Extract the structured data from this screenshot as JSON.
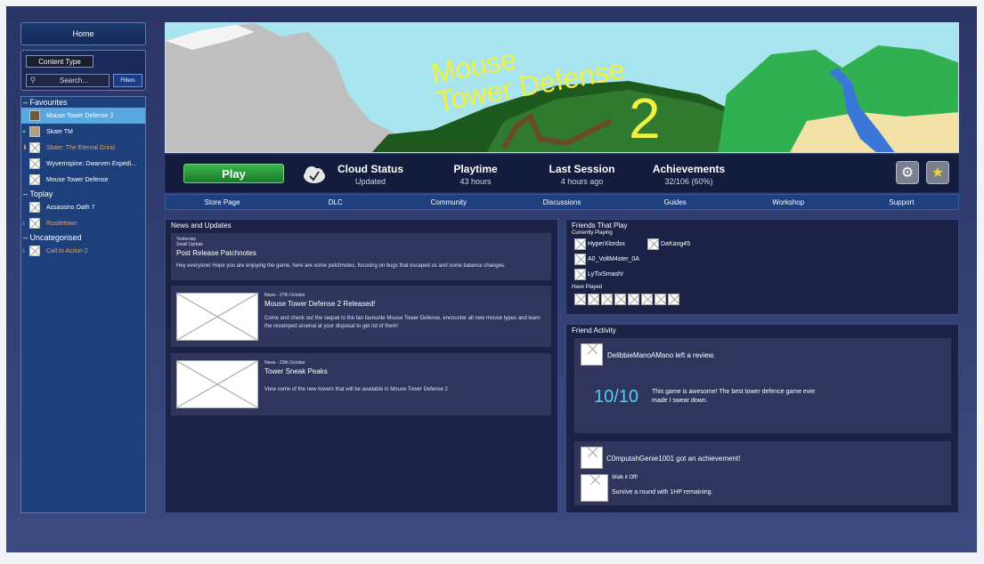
{
  "sidebar": {
    "home_label": "Home",
    "content_type_label": "Content Type",
    "search_placeholder": "Search...",
    "filters_label": "Filters",
    "categories": [
      {
        "name": "Favourites",
        "games": [
          {
            "title": "Mouse Tower Defense 2",
            "selected": true,
            "status": ""
          },
          {
            "title": "Skate TM",
            "selected": false,
            "status": "online"
          },
          {
            "title": "Skate: The Eternal Grind",
            "selected": false,
            "status": "update"
          },
          {
            "title": "Wyvernspine: Dwarven Expedi...",
            "selected": false,
            "status": ""
          },
          {
            "title": "Mouse Tower Defense",
            "selected": false,
            "status": ""
          }
        ]
      },
      {
        "name": "Toplay",
        "games": [
          {
            "title": "Assassins Oath 7",
            "selected": false,
            "status": ""
          },
          {
            "title": "Rustletown",
            "selected": false,
            "status": "download"
          }
        ]
      },
      {
        "name": "Uncategorised",
        "games": [
          {
            "title": "Call to Action 2",
            "selected": false,
            "status": "download"
          }
        ]
      }
    ]
  },
  "hero": {
    "logo_text_line1": "Mouse",
    "logo_text_line2": "Tower Defense",
    "logo_number": "2"
  },
  "infobar": {
    "play_label": "Play",
    "cloud_status_title": "Cloud Status",
    "cloud_status_value": "Updated",
    "playtime_title": "Playtime",
    "playtime_value": "43 hours",
    "last_session_title": "Last Session",
    "last_session_value": "4 hours ago",
    "achievements_title": "Achievements",
    "achievements_value": "32/106 (60%)"
  },
  "tabs": [
    "Store Page",
    "DLC",
    "Community",
    "Discussions",
    "Guides",
    "Workshop",
    "Support"
  ],
  "news": {
    "title": "News and Updates",
    "items": [
      {
        "date": "Yesterday",
        "type": "Small Update",
        "headline": "Post Release Patchnotes",
        "body": "Hey everyone! Hope you are enjoying the game, here are some patchnotes, focusing on bugs that escaped us and some balance changes."
      },
      {
        "meta": "News - 27th October",
        "headline": "Mouse Tower Defense 2 Released!",
        "body": "Come and check out the sequel to the fan favourite Mouse Tower Defense, encounter all new mouse types and learn the revamped arsenal at your disposal to get rid of them!"
      },
      {
        "meta": "News - 23th October",
        "headline": "Tower Sneak Peaks",
        "body": "View some of the new towers that will be available in Mouse Tower Defense 2"
      }
    ]
  },
  "friends": {
    "title": "Friends That Play",
    "currently_playing_label": "Currently Playing",
    "currently_playing": [
      "HyperXlordxx",
      "DaKang45",
      "A0_VoltM4ster_0A",
      "LyTixSmash!"
    ],
    "have_played_label": "Have Played",
    "have_played_count": 8
  },
  "activity": {
    "title": "Friend Activity",
    "review": {
      "text": "DelibbieManoAMano left a review.",
      "score": "10/10",
      "quote": "This game is awesome! The best tower defence game ever made I swear down."
    },
    "achievement": {
      "text": "C0mputahGenie1001 got an achievement!",
      "name": "Walk it Off!",
      "desc": "Survive a round with 1HP remaining."
    }
  }
}
